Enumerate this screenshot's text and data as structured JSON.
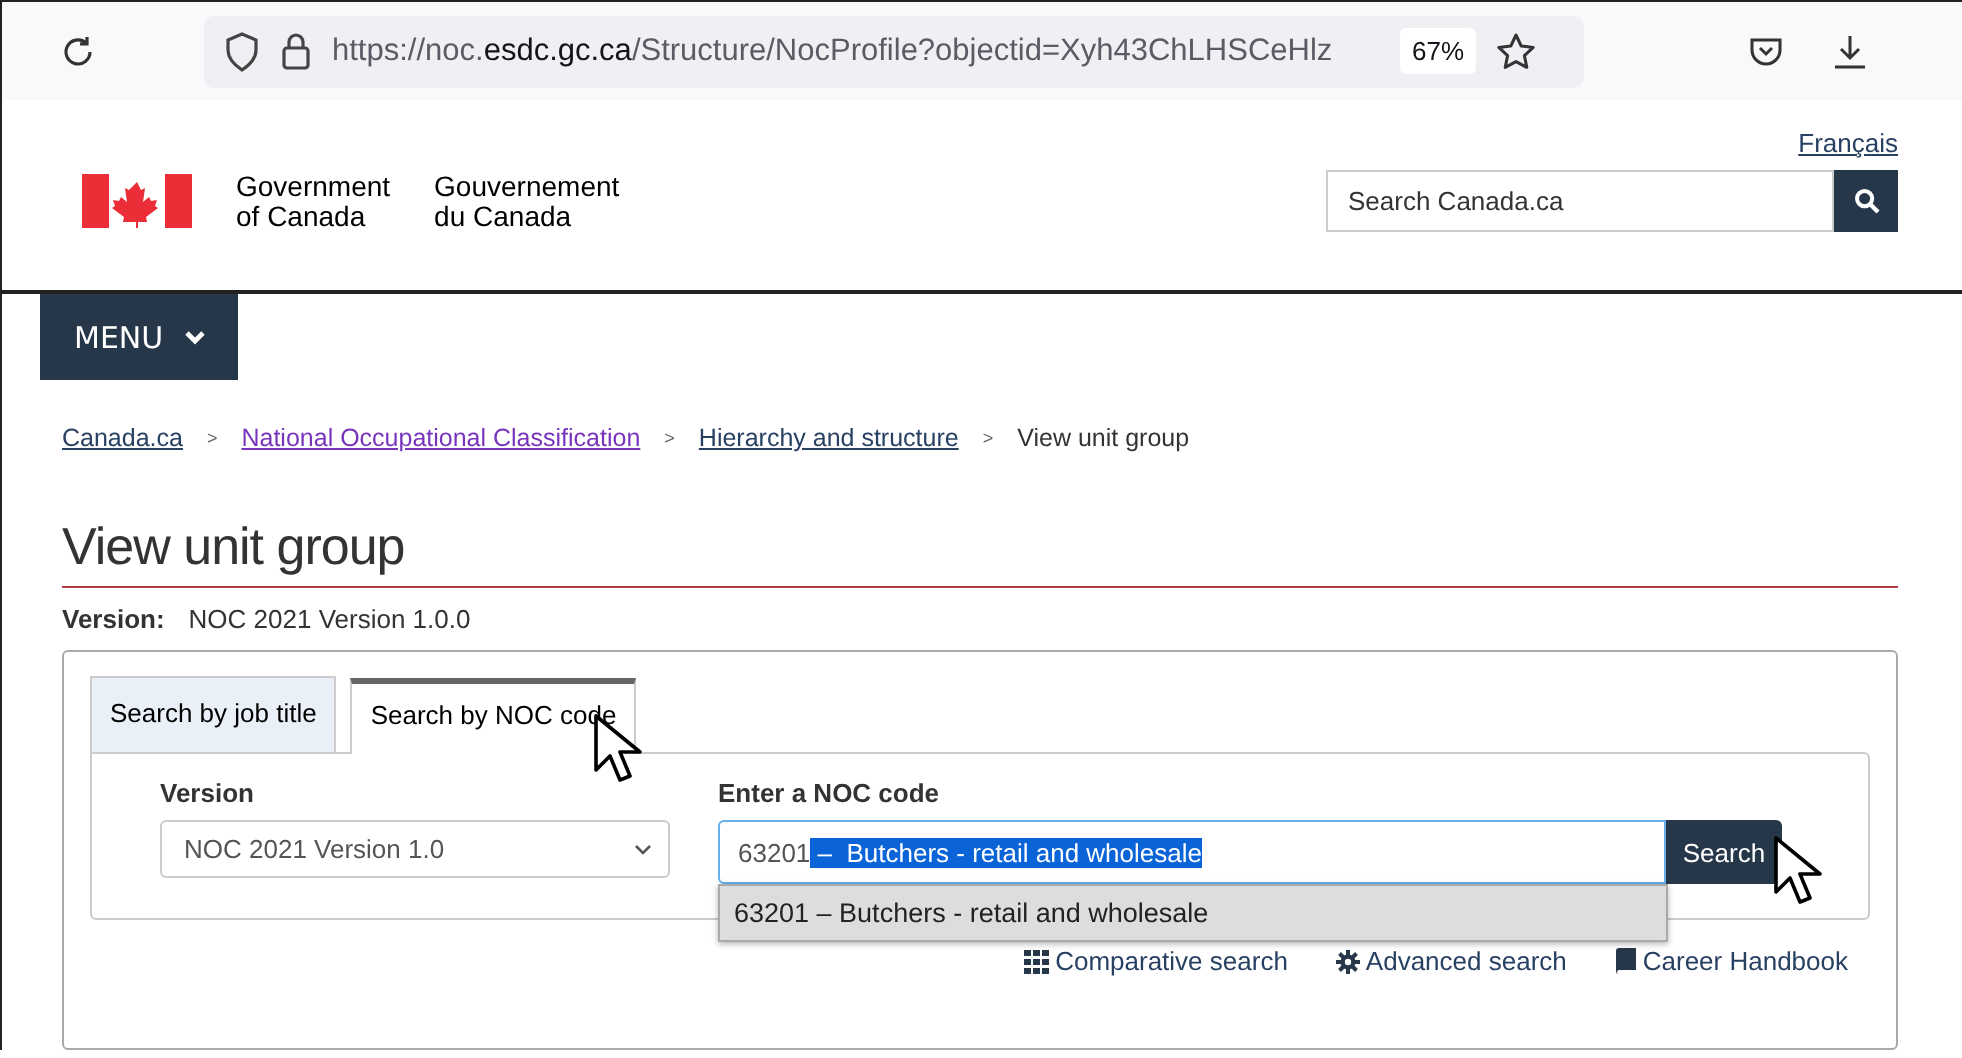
{
  "browser": {
    "url": {
      "scheme": "https://noc.",
      "domain": "esdc.gc.ca",
      "path": "/Structure/NocProfile?objectid=Xyh43ChLHSCeHlz"
    },
    "zoom": "67%"
  },
  "header": {
    "language_link": "Français",
    "signature": [
      "Government",
      "of Canada",
      "Gouvernement",
      "du Canada"
    ],
    "search": {
      "placeholder": "Search Canada.ca"
    }
  },
  "menu": {
    "label": "MENU"
  },
  "breadcrumb": [
    {
      "kind": "link",
      "label": "Canada.ca"
    },
    {
      "kind": "separator",
      "label": ">"
    },
    {
      "kind": "visited_link",
      "label": "National Occupational Classification"
    },
    {
      "kind": "separator",
      "label": ">"
    },
    {
      "kind": "link",
      "label": "Hierarchy and structure"
    },
    {
      "kind": "separator",
      "label": ">"
    },
    {
      "kind": "current",
      "label": "View unit group"
    }
  ],
  "title": "View unit group",
  "version": {
    "label": "Version:",
    "value": "NOC 2021 Version 1.0.0"
  },
  "tabs": [
    {
      "label": "Search by job title",
      "selected": false
    },
    {
      "label": "Search by NOC code",
      "selected": true
    }
  ],
  "form": {
    "version_label": "Version",
    "version_value": "NOC 2021 Version 1.0",
    "code_label": "Enter a NOC code",
    "code_value": "63201",
    "code_selected_text": " –  Butchers - retail and wholesale",
    "search_button": "Search",
    "suggestions": [
      "63201 – Butchers - retail and wholesale"
    ]
  },
  "links": [
    {
      "kind": "grid",
      "label": "Comparative search"
    },
    {
      "kind": "gear",
      "label": "Advanced search"
    },
    {
      "kind": "book",
      "label": "Career Handbook"
    }
  ]
}
